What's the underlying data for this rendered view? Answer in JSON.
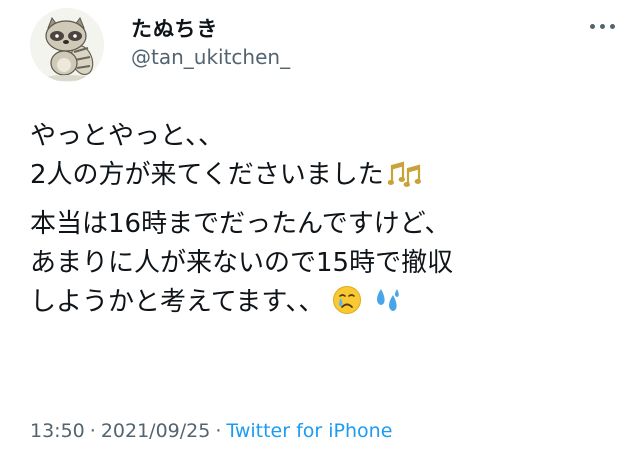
{
  "user": {
    "display_name": "たぬちき",
    "handle": "@tan_ukitchen_",
    "avatar_icon": "tanuki-avatar-icon"
  },
  "more_icon": "more-horizontal-icon",
  "tweet": {
    "para1": [
      "やっとやっと、、",
      "2人の方が来てくださいました"
    ],
    "para2": [
      "本当は16時までだったんですけど、",
      "あまりに人が来ないので15時で撤収",
      "しようかと考えてます、、"
    ],
    "emojis": [
      "music-notes-emoji",
      "crying-face-emoji",
      "sweat-droplets-emoji"
    ]
  },
  "meta": {
    "time": "13:50",
    "separator": "·",
    "date": "2021/09/25",
    "source": "Twitter for iPhone"
  },
  "colors": {
    "text": "#0f1419",
    "secondary": "#536471",
    "link": "#1d9bf0"
  }
}
